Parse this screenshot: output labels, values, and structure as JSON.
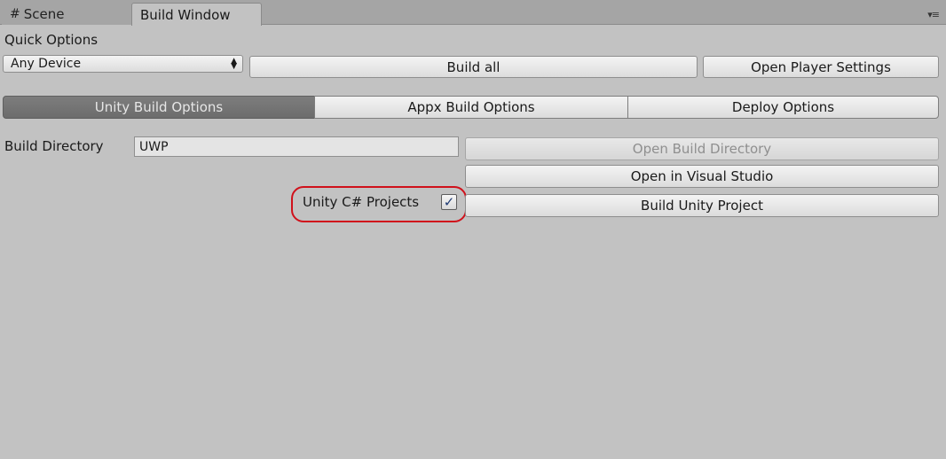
{
  "tabs": {
    "scene_icon": "#",
    "scene_label": "Scene",
    "build_label": "Build Window",
    "menu_icon": "▾≡"
  },
  "quick_options": {
    "title": "Quick Options",
    "device_selected": "Any Device",
    "build_all": "Build all",
    "open_player_settings": "Open Player Settings"
  },
  "toolbar": {
    "unity_build_options": "Unity Build Options",
    "appx_build_options": "Appx Build Options",
    "deploy_options": "Deploy Options",
    "active": "Unity Build Options"
  },
  "build": {
    "directory_label": "Build Directory",
    "directory_value": "UWP",
    "open_build_directory": "Open Build Directory",
    "open_in_visual_studio": "Open in Visual Studio",
    "unity_csharp_projects_label": "Unity C# Projects",
    "unity_csharp_projects_checked": "✓",
    "build_unity_project": "Build Unity Project"
  },
  "colors": {
    "background": "#c2c2c2",
    "highlight": "#d0111b",
    "active_tab": "#707070",
    "checkmark": "#1f3b73"
  }
}
